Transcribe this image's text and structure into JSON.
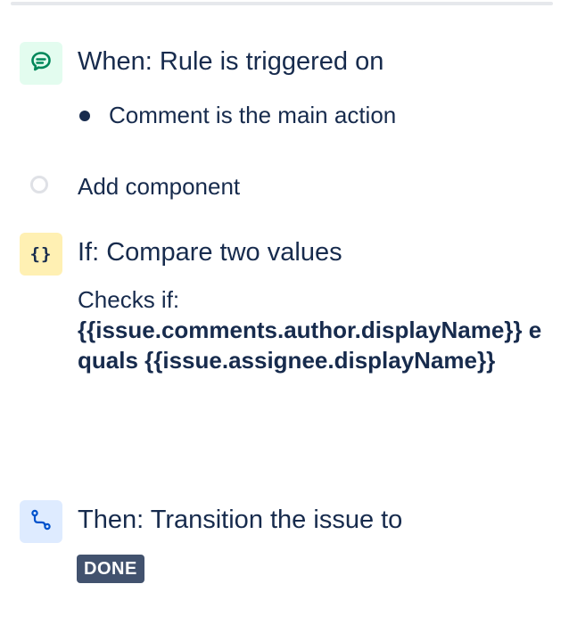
{
  "trigger": {
    "icon": "comment-icon",
    "title": "When: Rule is triggered on",
    "detail": "Comment is the main action",
    "accent": "#E3FCEF",
    "icon_color": "#00875A"
  },
  "add_component": {
    "label": "Add component"
  },
  "condition": {
    "icon": "braces-icon",
    "icon_glyph": "{}",
    "title": "If: Compare two values",
    "label": "Checks if:",
    "expression": "{{issue.comments.author.displayName}} equals {{issue.assignee.displayName}}",
    "accent": "#FFF0B3"
  },
  "action": {
    "icon": "transition-icon",
    "title": "Then: Transition the issue to",
    "status": "DONE",
    "accent": "#DEEBFF",
    "icon_color": "#0052CC",
    "status_color": "#42526E"
  }
}
